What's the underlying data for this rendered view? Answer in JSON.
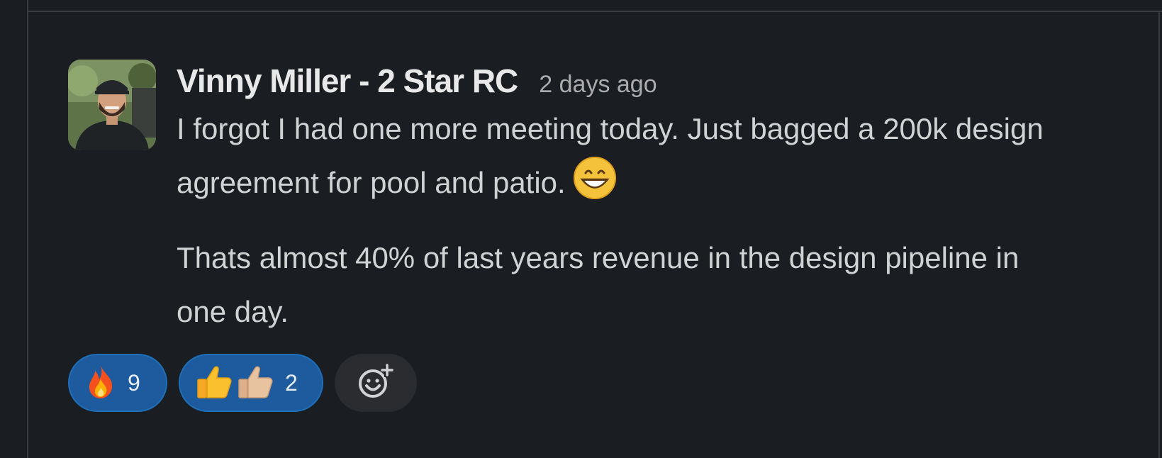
{
  "message": {
    "author": "Vinny Miller - 2 Star RC",
    "timestamp": "2 days ago",
    "paragraphs": [
      "I forgot I had one more meeting today. Just bagged a 200k design agreement for pool and patio.",
      "Thats almost 40% of last years revenue in the design pipeline in one day."
    ],
    "inline_emoji": "grinning-face-icon",
    "reactions": [
      {
        "emojis": [
          "fire-icon"
        ],
        "count": "9"
      },
      {
        "emojis": [
          "thumbs-up-icon",
          "thumbs-up-light-skin-icon"
        ],
        "count": "2"
      }
    ],
    "add_reaction_icon": "add-reaction-icon"
  },
  "colors": {
    "background": "#1a1d21",
    "reaction_pill": "#1d5a9e",
    "reaction_border": "#1d6fb8",
    "text_primary": "#d1d2d3",
    "text_muted": "#ababad"
  }
}
